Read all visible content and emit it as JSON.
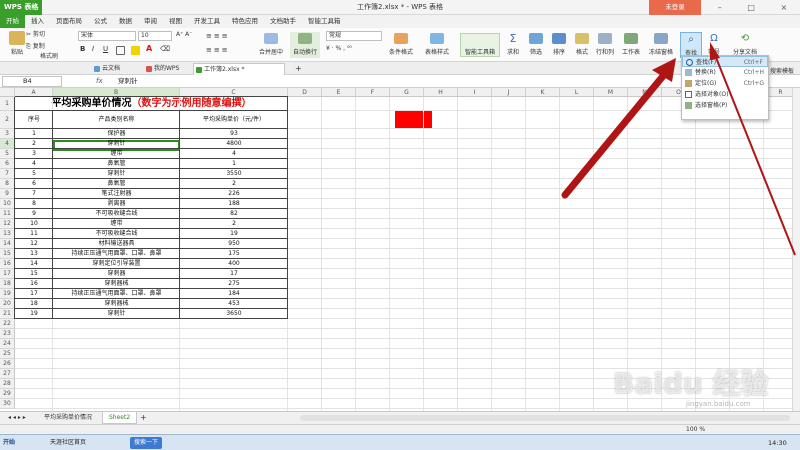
{
  "window": {
    "app_button": "WPS 表格",
    "title": "工作簿2.xlsx * - WPS 表格",
    "login": "未登录"
  },
  "menu": [
    "开始",
    "插入",
    "页面布局",
    "公式",
    "数据",
    "审阅",
    "视图",
    "开发工具",
    "特色应用",
    "文档助手",
    "智能工具箱"
  ],
  "ribbon": {
    "paste": "粘贴",
    "cut": "剪切",
    "copy": "复制",
    "format_painter": "格式刷",
    "font_name": "宋体",
    "font_size": "10",
    "merge_center": "合并居中",
    "wrap_text": "自动换行",
    "number_format": "常规",
    "cond_format": "条件格式",
    "table_style": "表格样式",
    "smart_toolbox": "智能工具箱",
    "sum": "求和",
    "filter": "筛选",
    "sort": "排序",
    "format": "格式",
    "row_col": "行和列",
    "worksheet": "工作表",
    "freeze": "冻结窗格",
    "find": "查找",
    "symbol": "符号",
    "share": "分享文档"
  },
  "find_menu": {
    "items": [
      {
        "label": "查找(F)",
        "shortcut": "Ctrl+F"
      },
      {
        "label": "替换(R)",
        "shortcut": "Ctrl+H"
      },
      {
        "label": "定位(G)",
        "shortcut": "Ctrl+G"
      },
      {
        "label": "选择对象(O)",
        "shortcut": ""
      },
      {
        "label": "选择窗格(P)",
        "shortcut": ""
      }
    ],
    "side_label": "搜索模板"
  },
  "doc_tabs": [
    "云文档",
    "我的WPS",
    "工作簿2.xlsx *"
  ],
  "formula_bar": {
    "name_box": "B4",
    "fx": "fx",
    "content": "穿刺针"
  },
  "columns": [
    "A",
    "B",
    "C",
    "D",
    "E",
    "F",
    "G",
    "H",
    "I",
    "J",
    "K",
    "L",
    "M",
    "N",
    "O",
    "P",
    "Q",
    "R",
    "S"
  ],
  "sheet": {
    "title_main": "平均采购单价情况",
    "title_note": "（数字为示例用随意编撰）",
    "headers": [
      "序号",
      "产品类别名称",
      "平均采购单价（元/件）"
    ],
    "rows": [
      [
        "1",
        "保护器",
        "93"
      ],
      [
        "2",
        "穿刺针",
        "4800"
      ],
      [
        "3",
        "缠带",
        "4"
      ],
      [
        "4",
        "鼻氧管",
        "1"
      ],
      [
        "5",
        "穿刺针",
        "3550"
      ],
      [
        "6",
        "鼻氧管",
        "2"
      ],
      [
        "7",
        "笔式注射器",
        "226"
      ],
      [
        "8",
        "剥离器",
        "188"
      ],
      [
        "9",
        "不可吸收缝合线",
        "82"
      ],
      [
        "10",
        "缠带",
        "2"
      ],
      [
        "11",
        "不可吸收缝合线",
        "19"
      ],
      [
        "12",
        "材料输送器具",
        "950"
      ],
      [
        "13",
        "持续正压通气用面罩、口罩、鼻罩",
        "175"
      ],
      [
        "14",
        "穿刺定位引导装置",
        "400"
      ],
      [
        "15",
        "穿刺器",
        "17"
      ],
      [
        "16",
        "穿刺器械",
        "275"
      ],
      [
        "17",
        "持续正压通气用面罩、口罩、鼻罩",
        "184"
      ],
      [
        "18",
        "穿刺器械",
        "453"
      ],
      [
        "19",
        "穿刺针",
        "3650"
      ]
    ],
    "row_numbers": [
      "1",
      "2",
      "3",
      "4",
      "5",
      "6",
      "7",
      "8",
      "9",
      "10",
      "11",
      "12",
      "13",
      "14",
      "15",
      "16",
      "17",
      "18",
      "19",
      "20",
      "21",
      "22",
      "23",
      "24",
      "25",
      "26",
      "27",
      "28",
      "29",
      "30"
    ]
  },
  "sheet_tabs": [
    "平均采购单价情况",
    "Sheet2"
  ],
  "status": {
    "zoom": "100 %"
  },
  "taskbar": {
    "start": "开始",
    "item1": "天涯社区首页",
    "search": "搜索一下",
    "clock": "14:30"
  },
  "watermark": {
    "text": "Baidu 经验",
    "sub": "jingyan.baidu.com"
  },
  "colors": {
    "accent_green": "#3a9e2b",
    "title_red": "#e01010",
    "fill_red": "#ff0000",
    "arrow": "#b01515"
  }
}
